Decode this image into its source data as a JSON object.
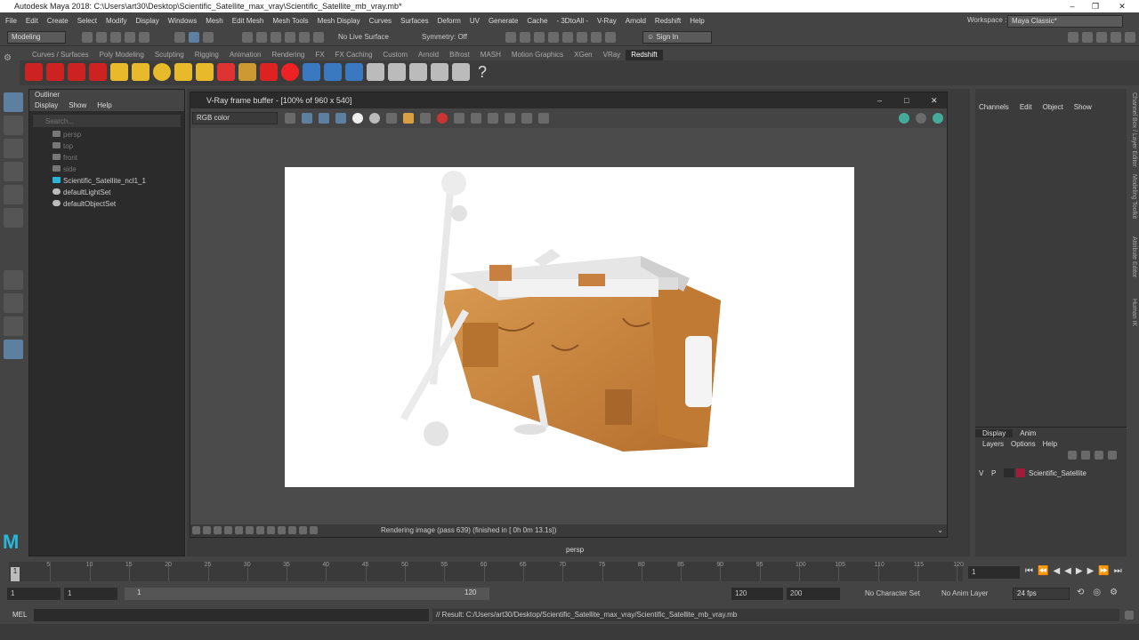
{
  "title_bar": {
    "text": "Autodesk Maya 2018: C:\\Users\\art30\\Desktop\\Scientific_Satellite_max_vray\\Scientific_Satellite_mb_vray.mb*",
    "min": "–",
    "max": "❐",
    "close": "✕"
  },
  "menu": [
    "File",
    "Edit",
    "Create",
    "Select",
    "Modify",
    "Display",
    "Windows",
    "Mesh",
    "Edit Mesh",
    "Mesh Tools",
    "Mesh Display",
    "Curves",
    "Surfaces",
    "Deform",
    "UV",
    "Generate",
    "Cache",
    "- 3DtoAll -",
    "V-Ray",
    "Arnold",
    "Redshift",
    "Help"
  ],
  "workspace": {
    "label": "Workspace :",
    "value": "Maya Classic*"
  },
  "status_line": {
    "mode": "Modeling",
    "live_surface": "No Live Surface",
    "symmetry": "Symmetry: Off",
    "sign_in": "Sign In"
  },
  "shelf_tabs": [
    "Curves / Surfaces",
    "Poly Modeling",
    "Sculpting",
    "Rigging",
    "Animation",
    "Rendering",
    "FX",
    "FX Caching",
    "Custom",
    "Arnold",
    "Bifrost",
    "MASH",
    "Motion Graphics",
    "XGen",
    "VRay",
    "Redshift"
  ],
  "shelf_active": "Redshift",
  "outliner": {
    "title": "Outliner",
    "menu": [
      "Display",
      "Show",
      "Help"
    ],
    "search_placeholder": "Search...",
    "items": [
      {
        "label": "persp",
        "dim": true
      },
      {
        "label": "top",
        "dim": true
      },
      {
        "label": "front",
        "dim": true
      },
      {
        "label": "side",
        "dim": true
      },
      {
        "label": "Scientific_Satellite_ncl1_1",
        "dim": false
      },
      {
        "label": "defaultLightSet",
        "dim": false
      },
      {
        "label": "defaultObjectSet",
        "dim": false
      }
    ]
  },
  "vfb": {
    "title": "V-Ray frame buffer - [100% of 960 x 540]",
    "channel": "RGB color",
    "status": "Rendering image (pass 639) (finished in [ 0h  0m 13.1s])"
  },
  "viewport_label": "persp",
  "channel_box": {
    "menu": [
      "Channels",
      "Edit",
      "Object",
      "Show"
    ]
  },
  "layer_editor": {
    "tabs": [
      "Display",
      "Anim"
    ],
    "menu": [
      "Layers",
      "Options",
      "Help"
    ],
    "layer": {
      "v": "V",
      "p": "P",
      "name": "Scientific_Satellite"
    }
  },
  "side_tabs": [
    "Channel Box / Layer Editor",
    "Modeling Toolkit",
    "Attribute Editor",
    "Human IK"
  ],
  "timeline": {
    "ticks": [
      "5",
      "10",
      "15",
      "20",
      "25",
      "30",
      "35",
      "40",
      "45",
      "50",
      "55",
      "60",
      "65",
      "70",
      "75",
      "80",
      "85",
      "90",
      "95",
      "100",
      "105",
      "110",
      "115",
      "120"
    ],
    "current": "1",
    "frame_field": "1"
  },
  "range": {
    "start": "1",
    "anim_start": "1",
    "slider_start": "1",
    "slider_end": "120",
    "end": "120",
    "anim_end": "200",
    "character_set": "No Character Set",
    "anim_layer": "No Anim Layer",
    "fps": "24 fps"
  },
  "command": {
    "label": "MEL",
    "result": "// Result: C:/Users/art30/Desktop/Scientific_Satellite_max_vray/Scientific_Satellite_mb_vray.mb"
  }
}
